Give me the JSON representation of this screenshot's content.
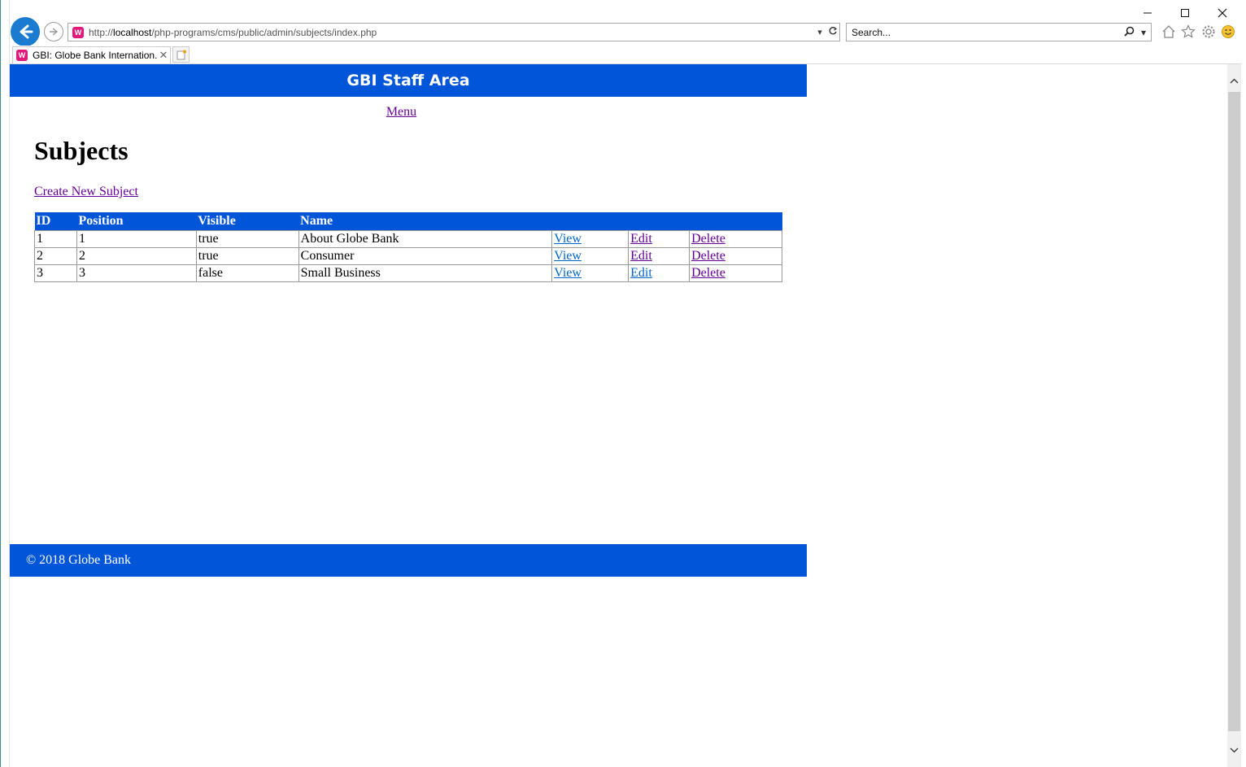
{
  "browser": {
    "address_url": "http://localhost/php-programs/cms/public/admin/subjects/index.php",
    "address_url_prefix": "http://",
    "address_url_host": "localhost",
    "address_url_path": "/php-programs/cms/public/admin/subjects/index.php",
    "search_placeholder": "Search...",
    "tab_title": "GBI: Globe Bank Internation...",
    "favicon_letter": "W"
  },
  "site": {
    "header_title": "GBI Staff Area",
    "menu_link": "Menu",
    "footer_text": "© 2018 Globe Bank",
    "brand_color": "#0055d9"
  },
  "main": {
    "title": "Subjects",
    "create_link": "Create New Subject",
    "table": {
      "headers": [
        "ID",
        "Position",
        "Visible",
        "Name",
        "",
        "",
        ""
      ],
      "rows": [
        {
          "id": "1",
          "position": "1",
          "visible": "true",
          "name": "About Globe Bank",
          "view": "View",
          "edit": "Edit",
          "delete": "Delete"
        },
        {
          "id": "2",
          "position": "2",
          "visible": "true",
          "name": "Consumer",
          "view": "View",
          "edit": "Edit",
          "delete": "Delete"
        },
        {
          "id": "3",
          "position": "3",
          "visible": "false",
          "name": "Small Business",
          "view": "View",
          "edit": "Edit",
          "delete": "Delete"
        }
      ]
    }
  }
}
